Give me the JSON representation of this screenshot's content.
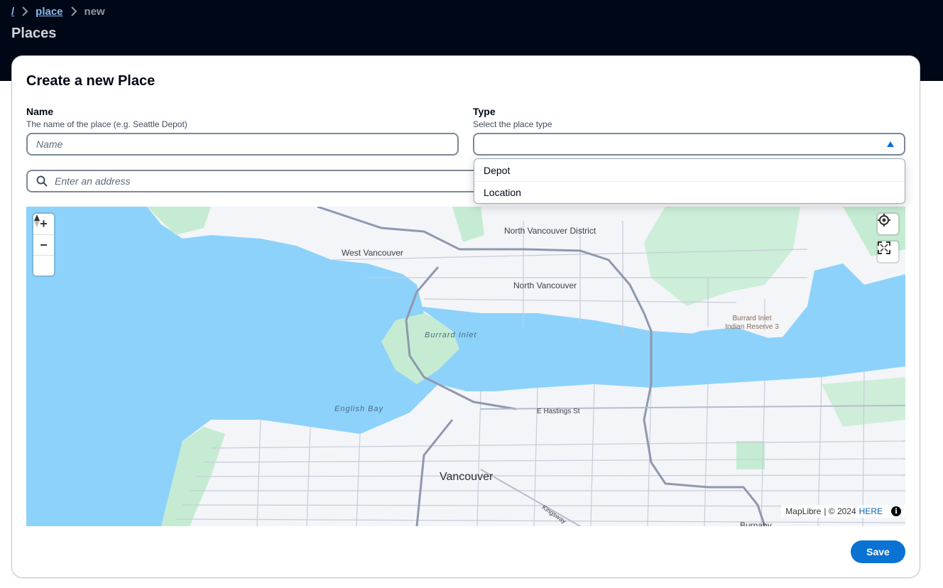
{
  "breadcrumb": {
    "root": "/",
    "section": "place",
    "current": "new"
  },
  "page": {
    "title": "Places"
  },
  "form": {
    "title": "Create a new Place",
    "name": {
      "label": "Name",
      "description": "The name of the place (e.g. Seattle Depot)",
      "placeholder": "Name",
      "value": ""
    },
    "type": {
      "label": "Type",
      "description": "Select the place type",
      "value": "",
      "expanded": true,
      "options": [
        "Depot",
        "Location"
      ]
    },
    "address": {
      "placeholder": "Enter an address",
      "value": ""
    },
    "save_label": "Save"
  },
  "map": {
    "labels": {
      "north_vancouver_district": "North Vancouver District",
      "west_vancouver": "West Vancouver",
      "north_vancouver": "North Vancouver",
      "burrard_inlet": "Burrard Inlet",
      "burrard_reserve": "Burrard Inlet Indian Reserve 3",
      "english_bay": "English Bay",
      "hastings": "E Hastings St",
      "vancouver": "Vancouver",
      "kingsway": "Kingsway",
      "burnaby": "Burnaby"
    },
    "controls": {
      "zoom_in": "+",
      "zoom_out": "−"
    },
    "attribution": {
      "maplibre": "MapLibre",
      "sep": "| © 2024",
      "provider": "HERE"
    },
    "colors": {
      "water": "#8dd2fb",
      "land": "#f3f5f8",
      "park": "#c5ecd2",
      "road": "#b5bccb",
      "highway": "#8f98ad"
    }
  },
  "colors": {
    "header_bg": "#000716",
    "accent": "#0972d3",
    "link": "#89bdee"
  }
}
